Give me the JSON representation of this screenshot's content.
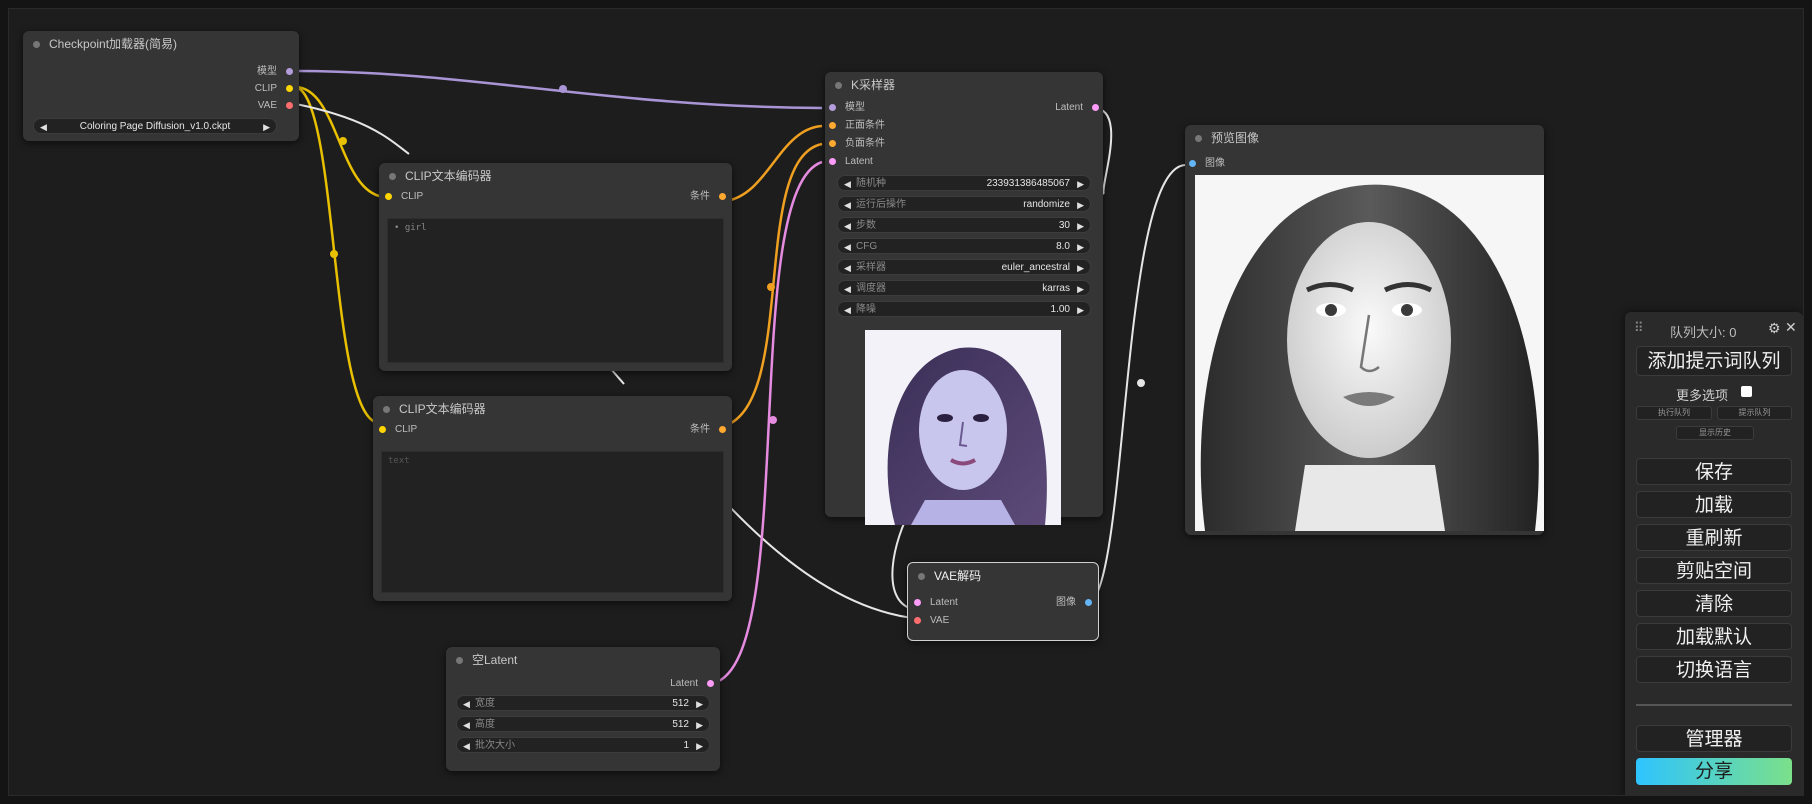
{
  "nodes": {
    "checkpoint": {
      "title": "Checkpoint加载器(简易)",
      "outputs": [
        "模型",
        "CLIP",
        "VAE"
      ],
      "ckpt_name": "Coloring Page Diffusion_v1.0.ckpt"
    },
    "clip_pos": {
      "title": "CLIP文本编码器",
      "input": "CLIP",
      "output": "条件",
      "text": "• girl"
    },
    "clip_neg": {
      "title": "CLIP文本编码器",
      "input": "CLIP",
      "output": "条件",
      "text": "text"
    },
    "ksampler": {
      "title": "K采样器",
      "inputs": [
        "模型",
        "正面条件",
        "负面条件",
        "Latent"
      ],
      "output": "Latent",
      "widgets": [
        {
          "label": "随机种",
          "value": "233931386485067"
        },
        {
          "label": "运行后操作",
          "value": "randomize"
        },
        {
          "label": "步数",
          "value": "30"
        },
        {
          "label": "CFG",
          "value": "8.0"
        },
        {
          "label": "采样器",
          "value": "euler_ancestral"
        },
        {
          "label": "调度器",
          "value": "karras"
        },
        {
          "label": "降噪",
          "value": "1.00"
        }
      ]
    },
    "preview": {
      "title": "预览图像",
      "input": "图像"
    },
    "vae_decode": {
      "title": "VAE解码",
      "inputs": [
        "Latent",
        "VAE"
      ],
      "output": "图像"
    },
    "empty_latent": {
      "title": "空Latent",
      "output": "Latent",
      "widgets": [
        {
          "label": "宽度",
          "value": "512"
        },
        {
          "label": "高度",
          "value": "512"
        },
        {
          "label": "批次大小",
          "value": "1"
        }
      ]
    }
  },
  "panel": {
    "queue_label": "队列大小: 0",
    "add_queue": "添加提示词队列",
    "more_options": "更多选项",
    "small_buttons": [
      "执行队列",
      "提示队列",
      "显示历史"
    ],
    "buttons": [
      "保存",
      "加载",
      "重刷新",
      "剪贴空间",
      "清除",
      "加载默认",
      "切换语言"
    ],
    "manager": "管理器",
    "share": "分享"
  },
  "colors": {
    "model": "#b39ddb",
    "clip": "#ffd500",
    "vae": "#ff6e6e",
    "conditioning": "#ffa931",
    "latent": "#ff9cf9",
    "image": "#64b5f6",
    "share_gradient_start": "#2ec4ff",
    "share_gradient_end": "#7be08a"
  }
}
